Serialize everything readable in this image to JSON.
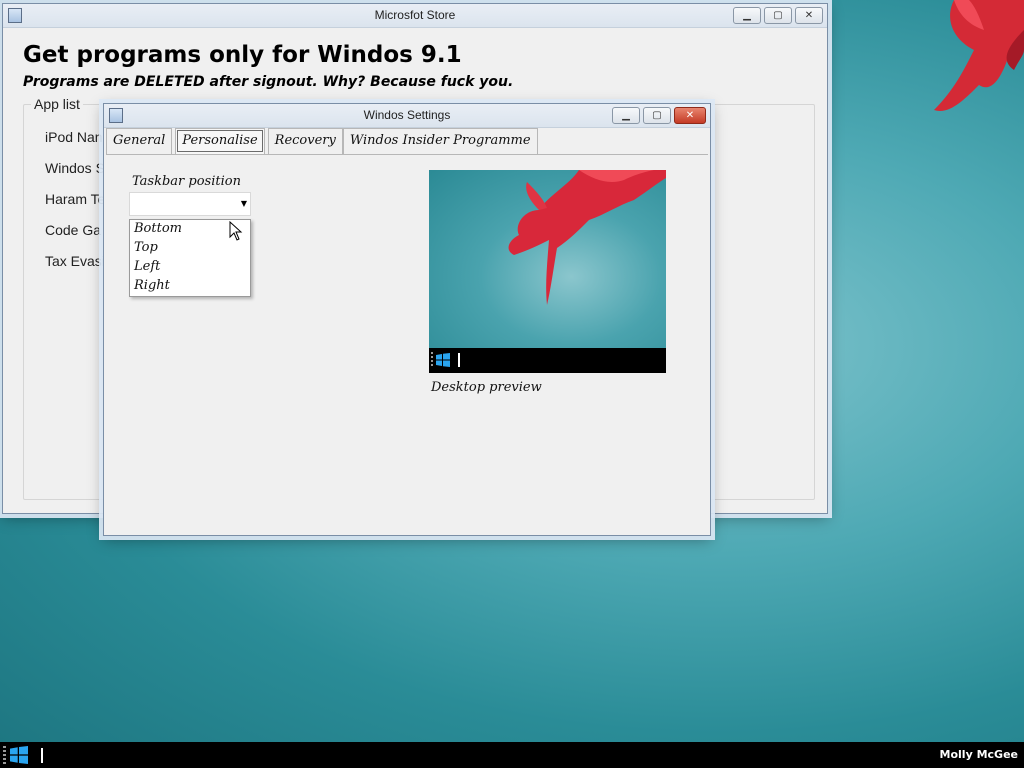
{
  "store": {
    "title": "Microsfot Store",
    "heading": "Get programs only for Windos 9.1",
    "subheading": "Programs are DELETED after signout. Why? Because fuck you.",
    "group_label": "App list",
    "apps": [
      "iPod Nan",
      "Windos S",
      "Haram Te",
      "Code Ga",
      "Tax Evasi"
    ]
  },
  "settings": {
    "title": "Windos Settings",
    "tabs": [
      "General",
      "Personalise",
      "Recovery",
      "Windos Insider Programme"
    ],
    "active_tab": "Personalise",
    "taskbar_position_label": "Taskbar position",
    "combo_value": "",
    "dropdown_options": [
      "Bottom",
      "Top",
      "Left",
      "Right"
    ],
    "preview_caption": "Desktop preview"
  },
  "taskbar": {
    "user_name": "Molly McGee"
  },
  "icons": {
    "start": "windows-logo-icon",
    "minimize": "minimize-icon",
    "maximize": "maximize-icon",
    "close": "close-icon",
    "cursor": "mouse-pointer-icon"
  },
  "colors": {
    "desktop": "#3a9aa5",
    "taskbar": "#000000",
    "close_button": "#c43b26",
    "start_logo": "#2aa5f0"
  }
}
